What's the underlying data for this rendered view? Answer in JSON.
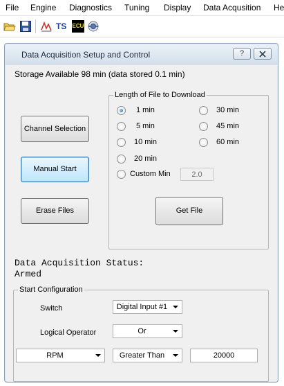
{
  "menu": [
    "File",
    "Engine",
    "Diagnostics",
    "Tuning",
    "Display",
    "Data Acqusition",
    "He"
  ],
  "toolbar": {
    "icons": [
      "open-folder-icon",
      "save-disk-icon",
      "signal-trace-icon",
      "ts-logo-icon",
      "ecu-icon",
      "connection-icon"
    ],
    "ts_label": "TS",
    "ecu_label": "ECU"
  },
  "dialog": {
    "title": "Data Acquisition Setup and Control",
    "help_button": "?",
    "storage_text": "Storage Available 98 min (data stored 0.1 min)",
    "buttons": {
      "channel_selection": "Channel Selection",
      "manual_start": "Manual Start",
      "erase_files": "Erase Files",
      "get_file": "Get File"
    },
    "file_length": {
      "legend": "Length of File to Download",
      "options": [
        "1 min",
        "30 min",
        "5 min",
        "45 min",
        "10 min",
        "60 min",
        "20 min",
        "Custom Min"
      ],
      "selected": "1 min",
      "custom_value": "2.0"
    },
    "status": {
      "label": "Data Acquisition Status:",
      "value": "Armed"
    },
    "start_config": {
      "legend": "Start Configuration",
      "switch_label": "Switch",
      "switch_value": "Digital Input #1",
      "logical_operator_label": "Logical Operator",
      "logical_operator_value": "Or",
      "channel_value": "RPM",
      "comparison_value": "Greater Than",
      "threshold_value": "20000"
    }
  }
}
